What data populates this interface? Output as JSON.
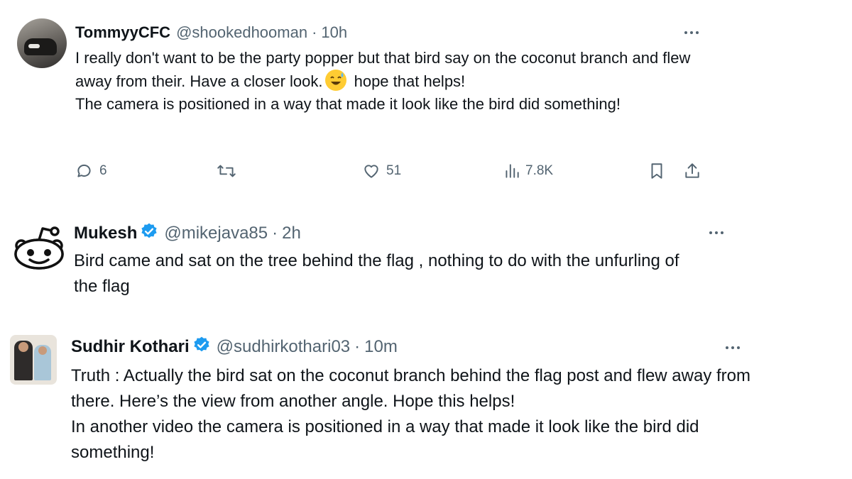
{
  "tweets": [
    {
      "name": "TommyyCFC",
      "handle": "@shookedhooman",
      "separator": "·",
      "time": "10h",
      "verified": false,
      "text_before_emoji": "I really don't want to be the party popper but that bird say on the coconut branch and flew away from their. Have a closer look.",
      "emoji": "sweat-smile-emoji",
      "text_after_emoji": " hope that helps!\nThe camera is positioned in a way that made it look like the bird did something!",
      "actions": {
        "replies": "6",
        "retweets": "",
        "likes": "51",
        "views": "7.8K"
      }
    },
    {
      "name": "Mukesh",
      "handle": "@mikejava85",
      "separator": "·",
      "time": "2h",
      "verified": true,
      "text": "Bird came and sat on  the tree behind the flag  , nothing to do with the unfurling of the flag"
    },
    {
      "name": "Sudhir Kothari",
      "handle": "@sudhirkothari03",
      "separator": "·",
      "time": "10m",
      "verified": true,
      "text": "Truth : Actually the bird sat on the coconut branch behind the flag post and flew away from there. Here’s the view from another angle. Hope this helps!\nIn another video the camera is positioned in a way that made it look like the bird did something!"
    }
  ],
  "colors": {
    "text": "#0f1419",
    "secondary": "#536471",
    "verified": "#1d9bf0",
    "emoji": "#ffcc33"
  }
}
